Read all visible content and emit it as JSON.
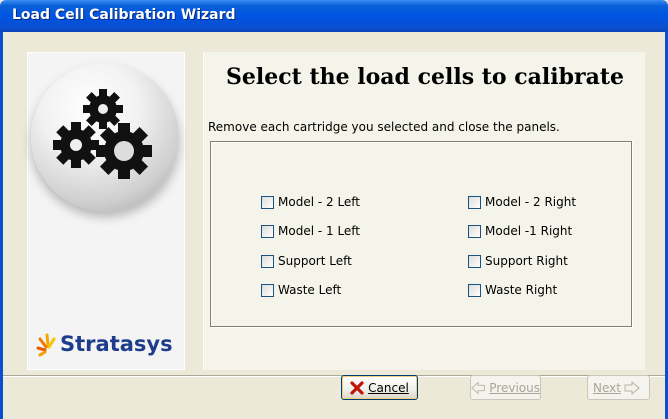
{
  "window": {
    "title": "Load Cell Calibration Wizard"
  },
  "side_panel": {
    "logo_text": "Stratasys",
    "graphic_icon": "gears-icon"
  },
  "main": {
    "heading": "Select the load cells to calibrate",
    "instruction": "Remove each cartridge you selected and close the panels.",
    "checkboxes_left": [
      {
        "label": "Model - 2 Left",
        "checked": false
      },
      {
        "label": "Model - 1 Left",
        "checked": false
      },
      {
        "label": "Support Left",
        "checked": false
      },
      {
        "label": "Waste Left",
        "checked": false
      }
    ],
    "checkboxes_right": [
      {
        "label": "Model - 2 Right",
        "checked": false
      },
      {
        "label": "Model -1 Right",
        "checked": false
      },
      {
        "label": "Support Right",
        "checked": false
      },
      {
        "label": "Waste Right",
        "checked": false
      }
    ]
  },
  "buttons": {
    "cancel_label": "Cancel",
    "previous_label": "Previous",
    "next_label": "Next",
    "previous_enabled": false,
    "next_enabled": false
  },
  "colors": {
    "titlebar": "#0054e3",
    "cancel_icon": "#c0140c",
    "logo_text": "#1d3d8c"
  }
}
